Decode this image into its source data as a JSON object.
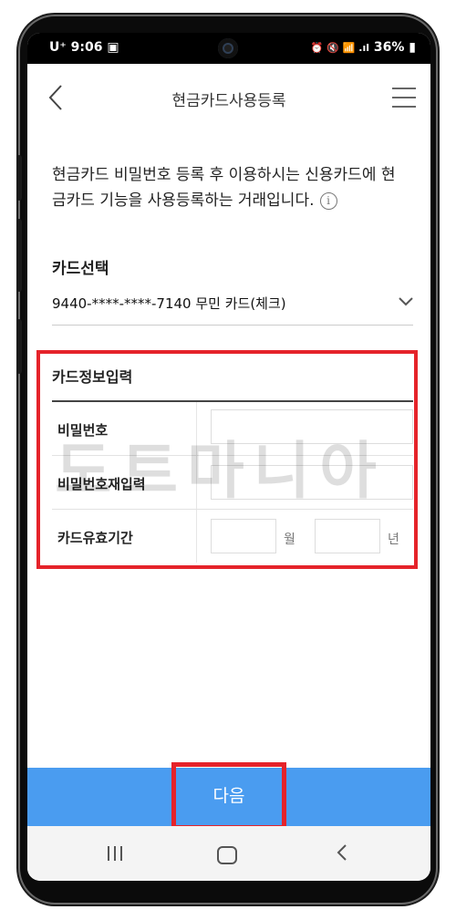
{
  "status": {
    "carrier": "U⁺",
    "time": "9:06",
    "battery": "36%",
    "indicators": "⏰ 🔇 📶 .ıl"
  },
  "header": {
    "title": "현금카드사용등록"
  },
  "description": {
    "line1": "현금카드 비밀번호 등록 후 이용하시는 신용카드에 현",
    "line2": "금카드 기능을 사용등록하는 거래입니다."
  },
  "card_select": {
    "label": "카드선택",
    "selected": "9440-****-****-7140 무민 카드(체크)"
  },
  "card_info": {
    "title": "카드정보입력",
    "rows": [
      {
        "label": "비밀번호"
      },
      {
        "label": "비밀번호재입력"
      },
      {
        "label": "카드유효기간"
      }
    ],
    "month_unit": "월",
    "year_unit": "년"
  },
  "watermark": "도트마니아",
  "next_button": {
    "label": "다음"
  },
  "colors": {
    "accent_blue": "#4a9cf0",
    "highlight_red": "#e5232a"
  }
}
